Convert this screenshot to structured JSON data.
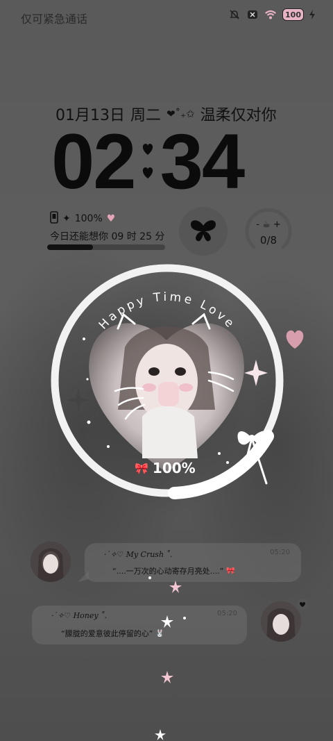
{
  "status_bar": {
    "carrier_text": "仅可紧急通话",
    "battery_level": "100",
    "icons": [
      "mute-icon",
      "no-sim-icon",
      "wifi-icon",
      "battery-icon",
      "charging-icon"
    ]
  },
  "lockscreen": {
    "date": "01月13日",
    "weekday": "周二",
    "slogan": "温柔仅对你",
    "time_hours": "02",
    "time_minutes": "34",
    "battery_info": "100%",
    "countdown_text": "今日还能想你 09 时 25 分",
    "countdown_progress": 0.39,
    "water_count": "0/8",
    "ring_title": "Happy Time Love",
    "ring_percent": "100%"
  },
  "chats": [
    {
      "name": "·˙✧♡ My Crush ˚.",
      "time": "05:20",
      "message": "“....一万次的心动寄存月亮处....”"
    },
    {
      "name": "·˙✧♡ Honey ˚.",
      "time": "05:20",
      "message": "“朦胧的爱意彼此停留的心”"
    }
  ],
  "colors": {
    "background": "#5b5b5b",
    "text": "#111111",
    "ring": "#f2f2f2",
    "battery_pink": "#e9b3c6",
    "heart_pink": "#e5a6b8"
  }
}
